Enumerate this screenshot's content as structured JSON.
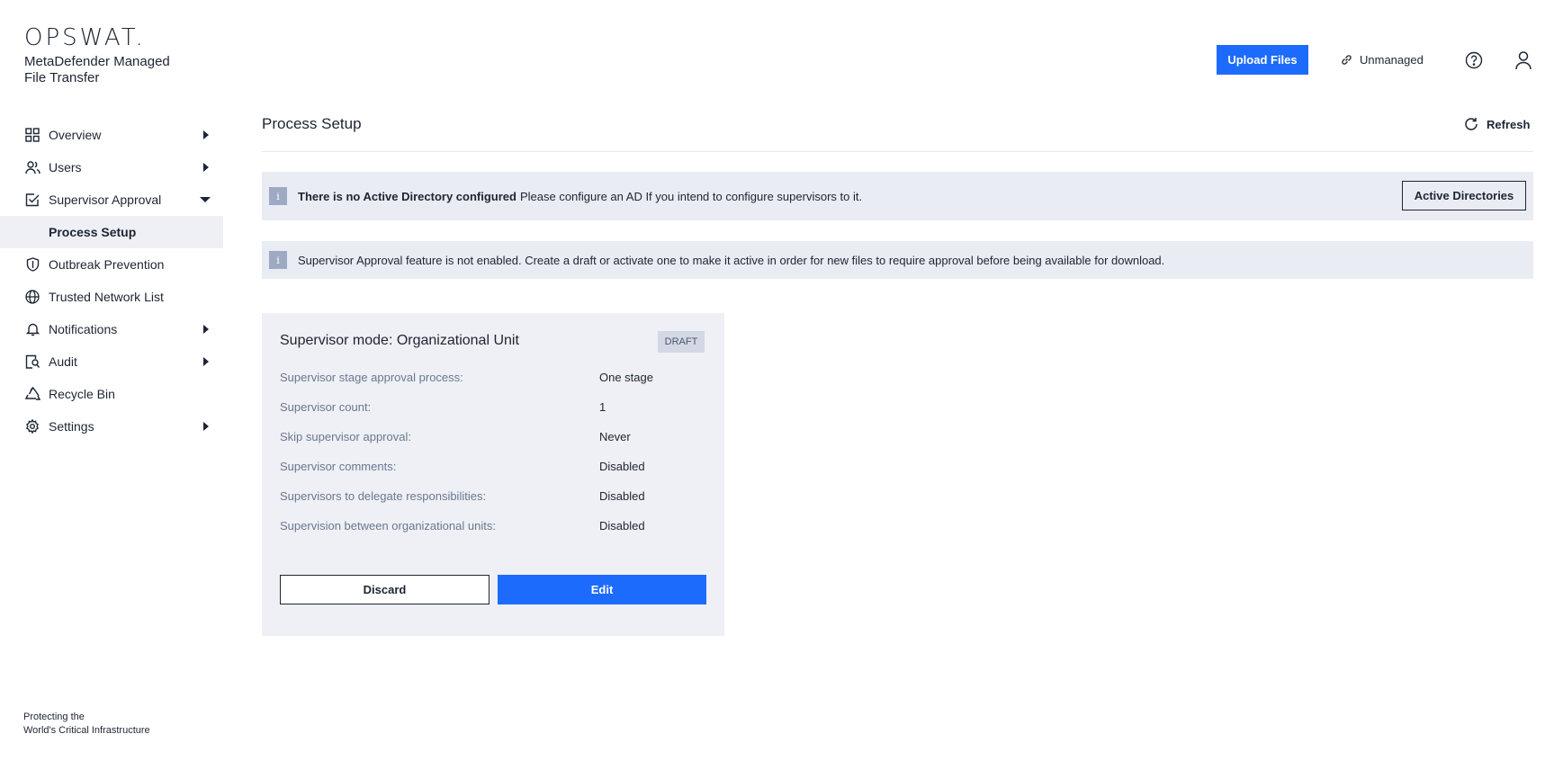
{
  "brand": {
    "logo_text": "OPSWAT.",
    "product_name": "MetaDefender Managed File Transfer",
    "tagline_line1": "Protecting the",
    "tagline_line2": "World's Critical Infrastructure"
  },
  "header": {
    "upload_label": "Upload Files",
    "unmanaged_label": "Unmanaged",
    "accent_color": "#1d6bfc"
  },
  "sidebar": {
    "items": [
      {
        "label": "Overview",
        "icon": "grid-icon",
        "expandable": true
      },
      {
        "label": "Users",
        "icon": "users-icon",
        "expandable": true
      },
      {
        "label": "Supervisor Approval",
        "icon": "checkbox-icon",
        "expandable": true,
        "expanded": true
      },
      {
        "label": "Outbreak Prevention",
        "icon": "shield-icon",
        "expandable": false
      },
      {
        "label": "Trusted Network List",
        "icon": "globe-icon",
        "expandable": false
      },
      {
        "label": "Notifications",
        "icon": "bell-icon",
        "expandable": true
      },
      {
        "label": "Audit",
        "icon": "audit-icon",
        "expandable": true
      },
      {
        "label": "Recycle Bin",
        "icon": "recycle-icon",
        "expandable": false
      },
      {
        "label": "Settings",
        "icon": "gear-icon",
        "expandable": true
      }
    ],
    "sub_item": "Process Setup"
  },
  "main": {
    "title": "Process Setup",
    "refresh_label": "Refresh",
    "alerts": [
      {
        "icon": "i",
        "bold": "There is no Active Directory configured",
        "text": "Please configure an AD If you intend to configure supervisors to it.",
        "button": "Active Directories"
      },
      {
        "icon": "i",
        "text": "Supervisor Approval feature is not enabled. Create a draft or activate one to make it active in order for new files to require approval before being available for download."
      }
    ],
    "card": {
      "title": "Supervisor mode: Organizational Unit",
      "badge": "DRAFT",
      "rows": [
        {
          "key": "Supervisor stage approval process:",
          "value": "One stage"
        },
        {
          "key": "Supervisor count:",
          "value": "1"
        },
        {
          "key": "Skip supervisor approval:",
          "value": "Never"
        },
        {
          "key": "Supervisor comments:",
          "value": "Disabled"
        },
        {
          "key": "Supervisors to delegate responsibilities:",
          "value": "Disabled"
        },
        {
          "key": "Supervision between organizational units:",
          "value": "Disabled"
        }
      ],
      "discard_label": "Discard",
      "edit_label": "Edit"
    }
  }
}
